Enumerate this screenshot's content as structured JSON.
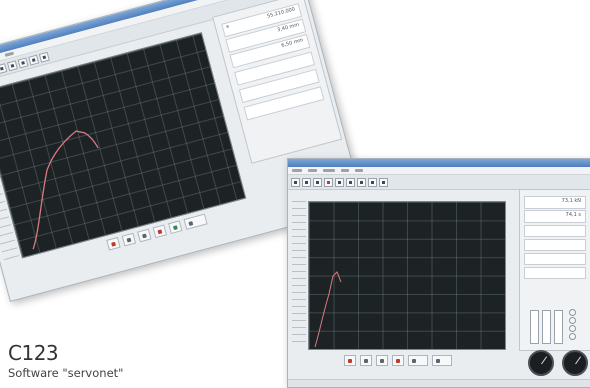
{
  "product_code": "C123",
  "caption": "Software \"servonet\"",
  "window_back": {
    "fields": [
      {
        "value": "55.210.000"
      },
      {
        "value": "3,40 mm"
      },
      {
        "value": "6,50 mm"
      }
    ]
  },
  "window_front": {
    "fields": [
      {
        "value": "73,1 kN"
      },
      {
        "value": "74,1 s"
      }
    ]
  },
  "colors": {
    "plot_background": "#1d2324",
    "curve": "#d97a82",
    "window_chrome": "#e9edf0",
    "title_bar": "#4f7fbf"
  },
  "icons": [
    "record-icon",
    "stop-icon",
    "print-icon",
    "export-icon"
  ]
}
